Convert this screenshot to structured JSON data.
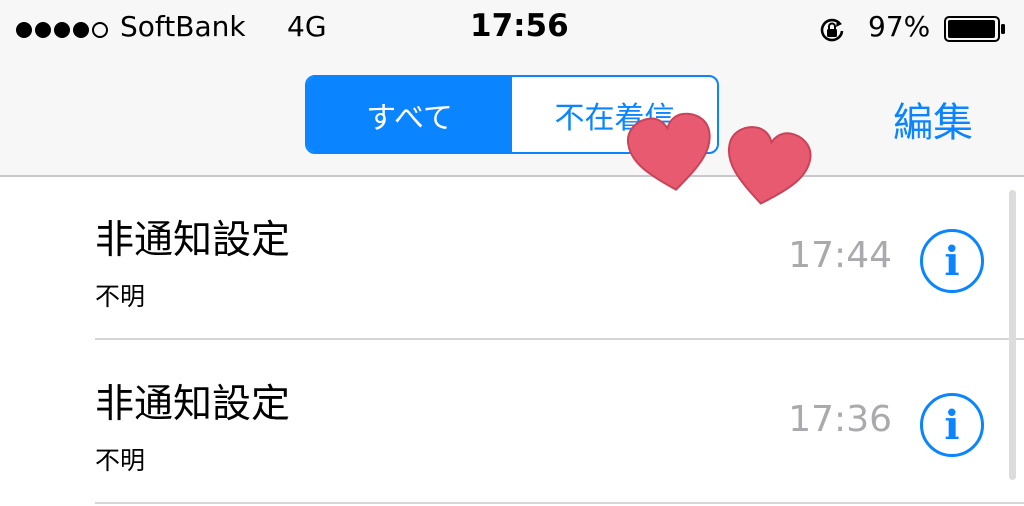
{
  "status_bar": {
    "carrier": "SoftBank",
    "network": "4G",
    "time": "17:56",
    "battery_percent": "97%",
    "signal_icon": "signal-dots-icon",
    "orientation_lock_icon": "orientation-lock-icon",
    "battery_icon": "battery-icon"
  },
  "nav": {
    "segments": [
      {
        "label": "すべて",
        "selected": true
      },
      {
        "label": "不在着信",
        "selected": false
      }
    ],
    "edit_label": "編集"
  },
  "calls": [
    {
      "name": "非通知設定",
      "type": "不明",
      "time": "17:44",
      "info_icon": "info-icon"
    },
    {
      "name": "非通知設定",
      "type": "不明",
      "time": "17:36",
      "info_icon": "info-icon"
    }
  ],
  "stickers": [
    "heart-sticker",
    "heart-sticker"
  ],
  "colors": {
    "accent": "#0a84ff",
    "heart": "#e85a70",
    "time_gray": "#a9a9ae"
  }
}
